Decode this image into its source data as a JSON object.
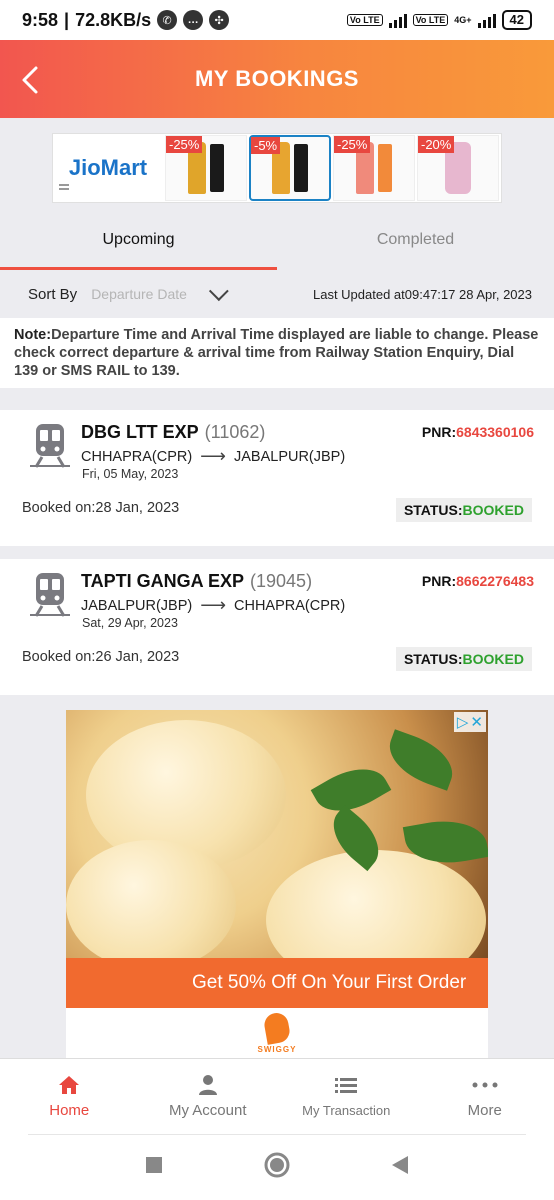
{
  "status_bar": {
    "time": "9:58",
    "net_speed": "72.8KB/s",
    "volte1": "Vo LTE",
    "volte2": "Vo LTE",
    "network": "4G+",
    "battery": "42"
  },
  "header": {
    "title": "MY BOOKINGS",
    "back_icon": "chevron-left-icon"
  },
  "banner": {
    "brand": "JioMart",
    "products": [
      {
        "discount": "-25%",
        "color": "#e0a52a",
        "box": "#1a1a1a"
      },
      {
        "discount": "-5%",
        "color": "#e7a530",
        "box": "#1a1a1a"
      },
      {
        "discount": "-25%",
        "color": "#f08a7b",
        "box": "#f28a3a"
      },
      {
        "discount": "-20%",
        "color": "#e7b7cf",
        "box": "#f3e6ee"
      }
    ]
  },
  "tabs": {
    "upcoming": "Upcoming",
    "completed": "Completed"
  },
  "sort": {
    "label": "Sort By",
    "placeholder": "Departure Date",
    "last_updated": "Last Updated at09:47:17 28 Apr, 2023"
  },
  "note": {
    "label": "Note:",
    "text": "Departure Time and Arrival Time displayed are liable to change. Please check correct departure & arrival time from Railway Station Enquiry, Dial 139 or SMS RAIL to 139."
  },
  "bookings": [
    {
      "train_name": "DBG LTT EXP",
      "train_no": "(11062)",
      "pnr_label": "PNR:",
      "pnr": "6843360106",
      "from": "CHHAPRA(CPR)",
      "to": "JABALPUR(JBP)",
      "date": "Fri, 05 May, 2023",
      "booked_label": "Booked on:",
      "booked_on": "28 Jan, 2023",
      "status_label": "STATUS:",
      "status": "BOOKED"
    },
    {
      "train_name": "TAPTI GANGA EXP",
      "train_no": "(19045)",
      "pnr_label": "PNR:",
      "pnr": "8662276483",
      "from": "JABALPUR(JBP)",
      "to": "CHHAPRA(CPR)",
      "date": "Sat, 29 Apr, 2023",
      "booked_label": "Booked on:",
      "booked_on": "26 Jan, 2023",
      "status_label": "STATUS:",
      "status": "BOOKED"
    }
  ],
  "ad": {
    "offer": "Get 50% Off On Your First Order",
    "brand": "SWIGGY"
  },
  "bottom_nav": {
    "items": [
      {
        "label": "Home",
        "icon": "home-icon"
      },
      {
        "label": "My Account",
        "icon": "person-icon"
      },
      {
        "label": "My Transaction",
        "icon": "list-icon"
      },
      {
        "label": "More",
        "icon": "more-dots-icon"
      }
    ]
  },
  "colors": {
    "accent": "#ef5040",
    "header_gradient_start": "#f2564f",
    "header_gradient_end": "#f99a3a",
    "status_green": "#2ea12e"
  }
}
